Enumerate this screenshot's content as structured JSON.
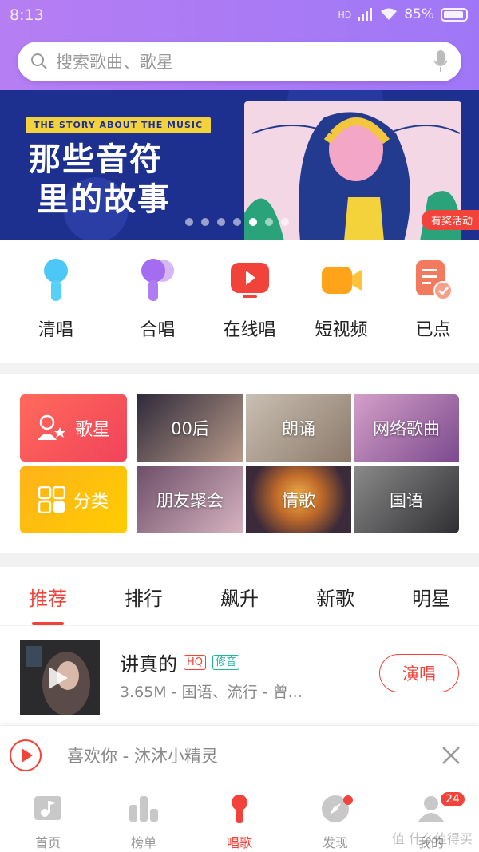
{
  "status": {
    "time": "8:13",
    "battery": "85%",
    "signal_label": "HD"
  },
  "search": {
    "placeholder": "搜索歌曲、歌星",
    "icon": "search-icon",
    "mic_icon": "mic-icon"
  },
  "banner": {
    "subtitle": "THE STORY ABOUT THE MUSIC",
    "title_line1": "那些音符",
    "title_line2": "里的故事",
    "tag": "有奖活动",
    "active_index": 4,
    "dot_count": 7
  },
  "quick_actions": [
    {
      "label": "清唱",
      "icon": "microphone-icon",
      "color": "#4cc7f6"
    },
    {
      "label": "合唱",
      "icon": "duet-microphone-icon",
      "color": "#a46cf0"
    },
    {
      "label": "在线唱",
      "icon": "live-play-icon",
      "color": "#f1433a"
    },
    {
      "label": "短视频",
      "icon": "video-camera-icon",
      "color": "#ffa31a"
    },
    {
      "label": "已点",
      "icon": "song-list-check-icon",
      "color": "#f47a5d"
    }
  ],
  "categories": {
    "singer": {
      "label": "歌星",
      "icon": "singer-icon"
    },
    "genre": {
      "label": "分类",
      "icon": "category-grid-icon"
    },
    "tiles": [
      "00后",
      "朗诵",
      "网络歌曲",
      "朋友聚会",
      "情歌",
      "国语"
    ]
  },
  "tabs": [
    {
      "label": "推荐",
      "active": true
    },
    {
      "label": "排行",
      "active": false
    },
    {
      "label": "飙升",
      "active": false
    },
    {
      "label": "新歌",
      "active": false
    },
    {
      "label": "明星",
      "active": false
    }
  ],
  "song": {
    "title": "讲真的",
    "tag_hq": "HQ",
    "tag_xiu": "修音",
    "meta": "3.65M - 国语、流行 - 曾...",
    "action": "演唱"
  },
  "player": {
    "text": "喜欢你 - 沐沐小精灵"
  },
  "bottom_nav": [
    {
      "label": "首页",
      "icon": "music-note-icon",
      "active": false
    },
    {
      "label": "榜单",
      "icon": "chart-bars-icon",
      "active": false
    },
    {
      "label": "唱歌",
      "icon": "microphone-icon",
      "active": true
    },
    {
      "label": "发现",
      "icon": "compass-icon",
      "active": false
    },
    {
      "label": "我的",
      "icon": "user-icon",
      "active": false,
      "badge": "24"
    }
  ],
  "watermark": "值 什么值得买",
  "colors": {
    "accent": "#f1433a",
    "header_from": "#b67ef3",
    "header_to": "#9f77f6",
    "banner_bg": "#1d2f8f"
  }
}
